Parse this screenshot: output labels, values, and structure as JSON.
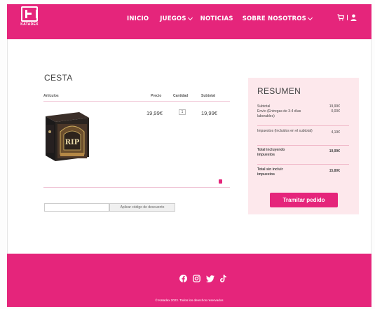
{
  "brand": {
    "logo_text": "KATADEX",
    "accent": "#e5257b",
    "summary_bg": "#fde8ec"
  },
  "nav": {
    "items": [
      {
        "label": "INICIO",
        "has_dropdown": false
      },
      {
        "label": "JUEGOS",
        "has_dropdown": true
      },
      {
        "label": "NOTICIAS",
        "has_dropdown": false
      },
      {
        "label": "SOBRE NOSOTROS",
        "has_dropdown": true
      }
    ],
    "icons": [
      "cart-icon",
      "user-icon"
    ]
  },
  "cart": {
    "title": "CESTA",
    "columns": {
      "items": "Artículos",
      "price": "Precio",
      "quantity": "Cantidad",
      "subtotal": "Subtotal"
    },
    "rows": [
      {
        "product_image": "rip-board-game-box",
        "price": "19,99€",
        "quantity": "1",
        "subtotal": "19,99€"
      }
    ],
    "coupon": {
      "placeholder": "",
      "button_label": "Aplicar código de descuento"
    }
  },
  "summary": {
    "title": "RESUMEN",
    "subtotal_label": "Subtotal",
    "subtotal_value": "19,99€",
    "shipping_label": "Envío (Entregas de 3-4 días laborables)",
    "shipping_value": "0,00€",
    "taxes_label": "Impuestos (Incluidos en el subtotal)",
    "taxes_value": "4,19€",
    "total_with_tax_label": "Total incluyendo impuestos",
    "total_with_tax_value": "19,99€",
    "total_without_tax_label": "Total sin incluir impuestos",
    "total_without_tax_value": "15,80€",
    "checkout_label": "Tramitar pedido"
  },
  "footer": {
    "social_icons": [
      "facebook-icon",
      "instagram-icon",
      "twitter-icon",
      "tiktok-icon"
    ],
    "copyright": "© Katadex 2023. Todos los derechos reservados"
  }
}
